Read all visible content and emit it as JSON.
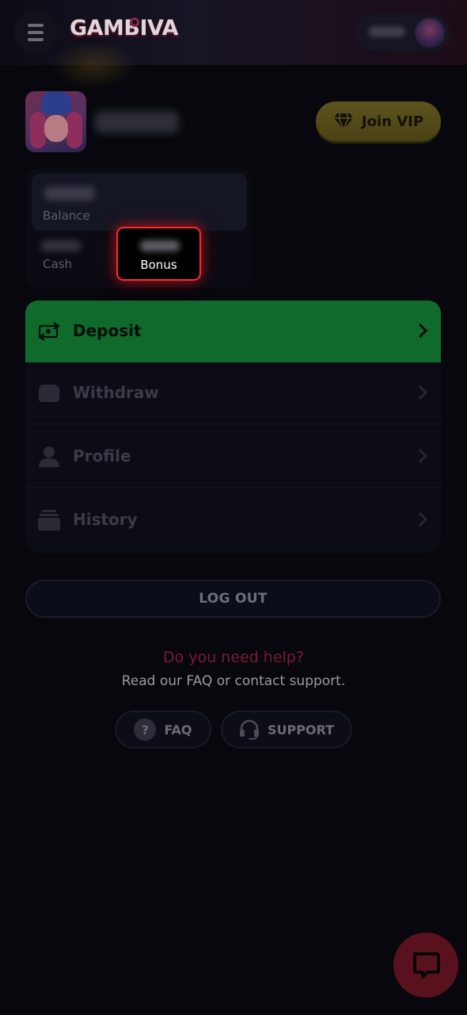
{
  "header": {
    "menu_icon": "hamburger-icon",
    "logo_text": "GAMBIVA",
    "balance_pill_icon": "user-avatar-icon"
  },
  "profile": {
    "vip_button_label": "Join VIP",
    "vip_icon": "diamond-icon"
  },
  "balance_card": {
    "balance_label": "Balance",
    "cash_label": "Cash",
    "bonus_label": "Bonus"
  },
  "menu": {
    "items": [
      {
        "label": "Deposit",
        "icon": "exchange-icon"
      },
      {
        "label": "Withdraw",
        "icon": "wallet-icon"
      },
      {
        "label": "Profile",
        "icon": "person-icon"
      },
      {
        "label": "History",
        "icon": "stack-icon"
      }
    ]
  },
  "logout_label": "LOG OUT",
  "help": {
    "title": "Do you need help?",
    "subtitle": "Read our FAQ or contact support.",
    "faq_label": "FAQ",
    "faq_icon_glyph": "?",
    "support_label": "SUPPORT"
  },
  "colors": {
    "background": "#07070d",
    "deposit_green": "#0f6a2c",
    "vip_gold": "#5c531e",
    "highlight_red": "#ff2a2a",
    "help_title": "#7a1a36",
    "chat_bubble": "#5a111e"
  },
  "chat_icon": "chat-bubble-icon"
}
